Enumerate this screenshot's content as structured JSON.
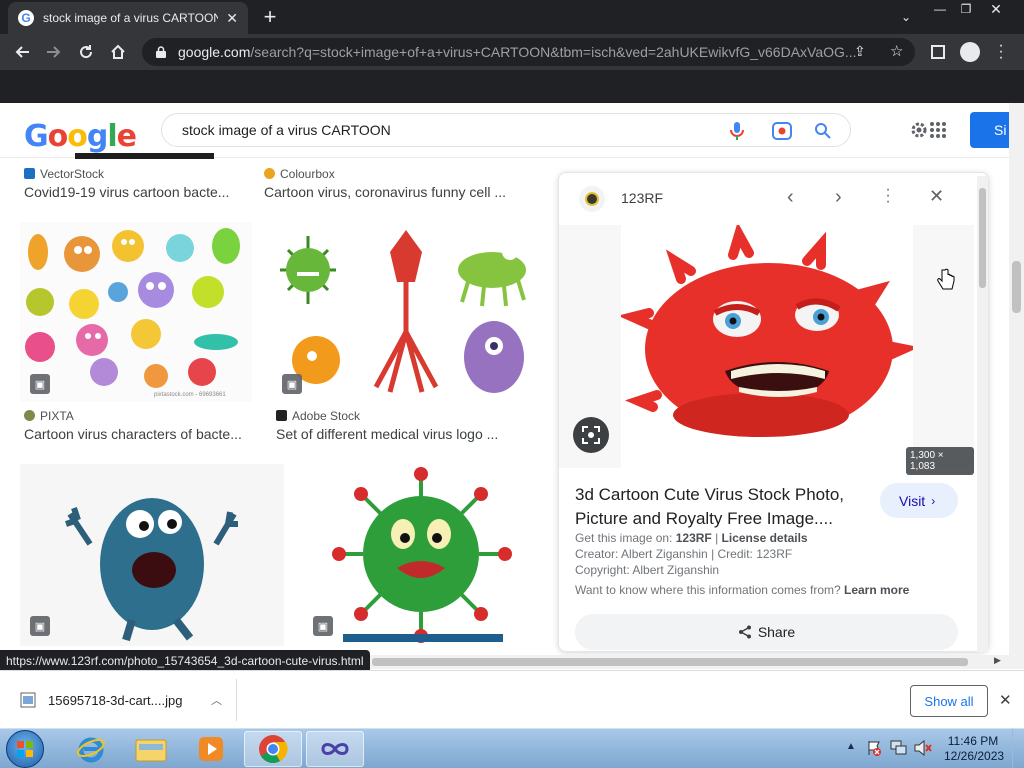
{
  "browser": {
    "tab_title": "stock image of a virus CARTOON",
    "url_host": "google.com",
    "url_rest": "/search?q=stock+image+of+a+virus+CARTOON&tbm=isch&ved=2ahUKEwikvfG_v66DAxVaOG..."
  },
  "search": {
    "logo_text": "Google",
    "query": "stock image of a virus CARTOON",
    "signin_label": "Si"
  },
  "results": {
    "row1": [
      {
        "source": "VectorStock",
        "caption": "Covid19-19 virus cartoon bacte..."
      },
      {
        "source": "Colourbox",
        "caption": "Cartoon virus, coronavirus funny cell ..."
      }
    ],
    "row2": [
      {
        "source": "PIXTA",
        "caption": "Cartoon virus characters of bacte...",
        "watermark": "pixtastock.com - 69693661"
      },
      {
        "source": "Adobe Stock",
        "caption": "Set of different medical virus logo ..."
      }
    ]
  },
  "panel": {
    "source_name": "123RF",
    "image_dims": "1,300 × 1,083",
    "title": "3d Cartoon Cute Virus Stock Photo, Picture and Royalty Free Image....",
    "visit_label": "Visit",
    "get_image_prefix": "Get this image on: ",
    "get_image_site": "123RF",
    "get_image_sep": " | ",
    "license_label": "License details",
    "creator_line": "Creator: Albert Ziganshin | Credit: 123RF",
    "copyright_line": "Copyright: Albert Ziganshin",
    "where_from": "Want to know where this information comes from? ",
    "learn_more": "Learn more",
    "share_label": "Share"
  },
  "status_url": "https://www.123rf.com/photo_15743654_3d-cartoon-cute-virus.html",
  "download": {
    "filename": "15695718-3d-cart....jpg",
    "show_all": "Show all"
  },
  "taskbar": {
    "time": "11:46 PM",
    "date": "12/26/2023"
  },
  "colors": {
    "google_blue": "#4285f4",
    "google_red": "#ea4335",
    "google_yellow": "#fbbc05",
    "google_green": "#34a853",
    "virus_red": "#e8302a",
    "virus_green": "#2e9e3a"
  }
}
